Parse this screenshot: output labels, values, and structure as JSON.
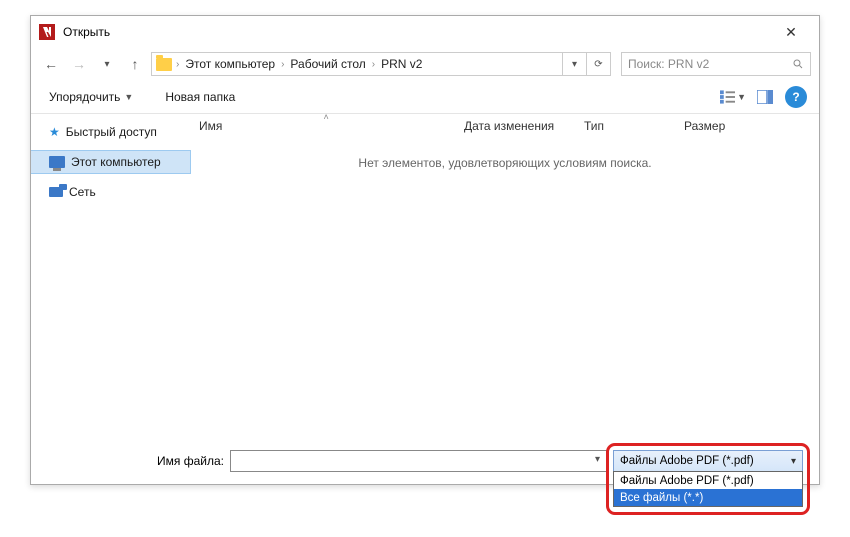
{
  "titlebar": {
    "title": "Открыть"
  },
  "nav": {
    "crumbs": [
      "Этот компьютер",
      "Рабочий стол",
      "PRN v2"
    ],
    "search_placeholder": "Поиск: PRN v2"
  },
  "toolbar": {
    "organize": "Упорядочить",
    "new_folder": "Новая папка"
  },
  "sidebar": {
    "quick_access": "Быстрый доступ",
    "this_pc": "Этот компьютер",
    "network": "Сеть"
  },
  "columns": {
    "name": "Имя",
    "date": "Дата изменения",
    "type": "Тип",
    "size": "Размер"
  },
  "empty_message": "Нет элементов, удовлетворяющих условиям поиска.",
  "footer": {
    "filename_label": "Имя файла:",
    "filter_selected": "Файлы Adobe PDF (*.pdf)",
    "filter_options": {
      "pdf": "Файлы Adobe PDF (*.pdf)",
      "all": "Все файлы (*.*)"
    }
  }
}
